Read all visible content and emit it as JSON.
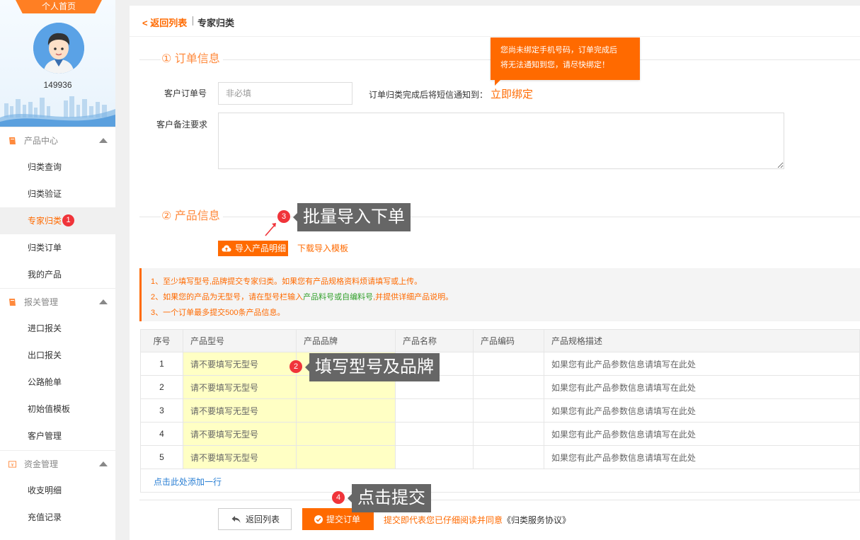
{
  "sidebar": {
    "home_label": "个人首页",
    "user_id": "149936",
    "groups": [
      {
        "label": "产品中心",
        "items": [
          "归类查询",
          "归类验证",
          "专家归类",
          "归类订单",
          "我的产品"
        ]
      },
      {
        "label": "报关管理",
        "items": [
          "进口报关",
          "出口报关",
          "公路舱单",
          "初始值模板",
          "客户管理"
        ]
      },
      {
        "label": "资金管理",
        "items": [
          "收支明细",
          "充值记录"
        ]
      }
    ],
    "active_badge": "1"
  },
  "header": {
    "back_label": "< 返回列表",
    "current": "专家归类"
  },
  "order_section": {
    "title": "① 订单信息",
    "order_no_label": "客户订单号",
    "order_no_placeholder": "非必填",
    "sms_label": "订单归类完成后将短信通知到：",
    "bind_link": "立即绑定",
    "tooltip_line1": "您尚未绑定手机号码，订单完成后",
    "tooltip_line2": "将无法通知到您，请尽快绑定！",
    "remark_label": "客户备注要求"
  },
  "product_section": {
    "title": "② 产品信息",
    "import_btn": "导入产品明细",
    "template_link": "下载导入模板",
    "notes": {
      "n1": "1、至少填写型号,品牌提交专家归类。如果您有产品规格资料烦请填写或上传。",
      "n2_a": "2、如果您的产品为无型号，请在型号栏输入",
      "n2_b": "产品料号或自编料号",
      "n2_c": ",并提供详细产品说明。",
      "n3": "3、一个订单最多提交500条产品信息。"
    },
    "columns": [
      "序号",
      "产品型号",
      "产品品牌",
      "产品名称",
      "产品编码",
      "产品规格描述"
    ],
    "rows": [
      {
        "no": "1",
        "model": "请不要填写无型号",
        "desc": "如果您有此产品参数信息请填写在此处"
      },
      {
        "no": "2",
        "model": "请不要填写无型号",
        "desc": "如果您有此产品参数信息请填写在此处"
      },
      {
        "no": "3",
        "model": "请不要填写无型号",
        "desc": "如果您有此产品参数信息请填写在此处"
      },
      {
        "no": "4",
        "model": "请不要填写无型号",
        "desc": "如果您有此产品参数信息请填写在此处"
      },
      {
        "no": "5",
        "model": "请不要填写无型号",
        "desc": "如果您有此产品参数信息请填写在此处"
      }
    ],
    "add_row": "点击此处添加一行"
  },
  "footer": {
    "back_btn": "返回列表",
    "submit_btn": "提交订单",
    "agree_a": "提交即代表您已仔细阅读并同意",
    "agree_b": "《归类服务协议》"
  },
  "callouts": {
    "c2": {
      "num": "2",
      "text": "填写型号及品牌"
    },
    "c3": {
      "num": "3",
      "text": "批量导入下单"
    },
    "c4": {
      "num": "4",
      "text": "点击提交"
    }
  },
  "colors": {
    "accent": "#ff6a00",
    "highlight_cell": "#ffffc4",
    "badge": "#f0343a",
    "callout_bg": "#666666"
  }
}
